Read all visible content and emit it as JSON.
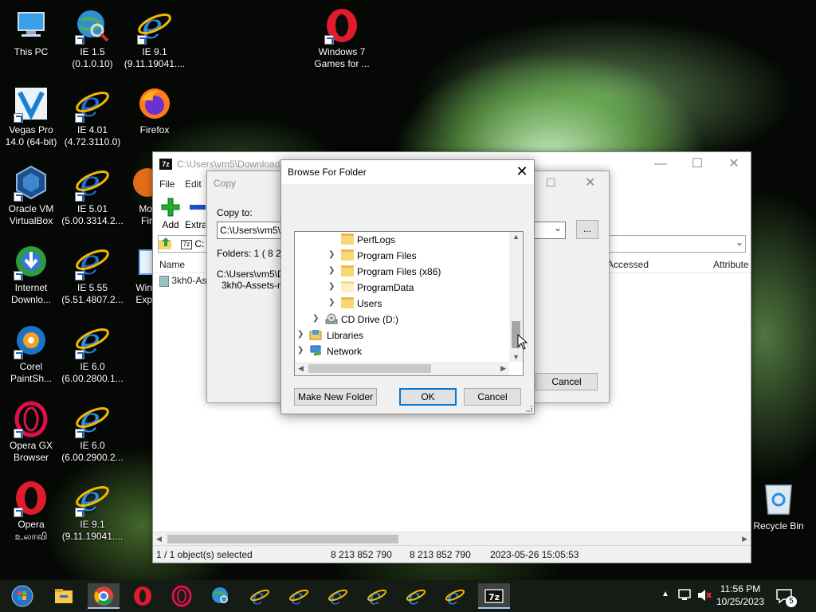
{
  "desktop": {
    "icons": [
      {
        "label": "This PC"
      },
      {
        "label": "IE 1.5\n(0.1.0.10)"
      },
      {
        "label": "IE 9.1\n(9.11.19041...."
      },
      {
        "label": "Windows 7\nGames for ..."
      },
      {
        "label": "Vegas Pro\n14.0 (64-bit)"
      },
      {
        "label": "IE 4.01\n(4.72.3110.0)"
      },
      {
        "label": "Firefox"
      },
      {
        "label": "Oracle VM\nVirtualBox"
      },
      {
        "label": "IE 5.01\n(5.00.3314.2..."
      },
      {
        "label": "Internet\nDownlo..."
      },
      {
        "label": "IE 5.55\n(5.51.4807.2..."
      },
      {
        "label": "Corel\nPaintSh..."
      },
      {
        "label": "IE 6.0\n(6.00.2800.1..."
      },
      {
        "label": "Opera GX\nBrowser"
      },
      {
        "label": "IE 6.0\n(6.00.2900.2..."
      },
      {
        "label": "Opera\nஉலாவி"
      },
      {
        "label": "IE 9.1\n(9.11.19041...."
      }
    ],
    "partial_labels": {
      "mo": "Mo",
      "fir": "Fir",
      "win": "Win",
      "exp": "Exp"
    },
    "recycle_bin": "Recycle Bin"
  },
  "sevenzip": {
    "title": "C:\\Users\\vm5\\Download",
    "app_icon": "7z",
    "menu": [
      "File",
      "Edit"
    ],
    "toolbar": {
      "add": "Add",
      "extract": "Extra"
    },
    "address": "C:",
    "columns": {
      "name": "Name",
      "accessed": "Accessed",
      "attributes": "Attribute"
    },
    "file_row": "3kh0-Ass",
    "status": {
      "selected": "1 / 1 object(s) selected",
      "size1": "8 213 852 790",
      "size2": "8 213 852 790",
      "date": "2023-05-26 15:05:53"
    }
  },
  "copy_dialog": {
    "title": "Copy",
    "copy_to_label": "Copy to:",
    "copy_to_value": "C:\\Users\\vm5\\D",
    "browse_label": "...",
    "folders_info": "Folders: 1    ( 8 2",
    "path_line1": "C:\\Users\\vm5\\Do",
    "path_line2": "3kh0-Assets-ma",
    "cancel": "Cancel"
  },
  "browse_dialog": {
    "title": "Browse For Folder",
    "tree": [
      {
        "label": "PerfLogs",
        "icon": "folder-icon",
        "expander": false
      },
      {
        "label": "Program Files",
        "icon": "folder-icon",
        "expander": true
      },
      {
        "label": "Program Files (x86)",
        "icon": "folder-icon",
        "expander": true
      },
      {
        "label": "ProgramData",
        "icon": "folder-icon",
        "expander": true
      },
      {
        "label": "Users",
        "icon": "folder-icon",
        "expander": true
      },
      {
        "label": "CD Drive (D:)",
        "icon": "cd-drive-icon",
        "expander": true
      },
      {
        "label": "Libraries",
        "icon": "libraries-icon",
        "expander": true
      },
      {
        "label": "Network",
        "icon": "network-icon",
        "expander": true
      }
    ],
    "make_new_folder": "Make New Folder",
    "ok": "OK",
    "cancel": "Cancel"
  },
  "taskbar": {
    "time": "11:56 PM",
    "date": "10/25/2023",
    "notification_count": "5"
  }
}
